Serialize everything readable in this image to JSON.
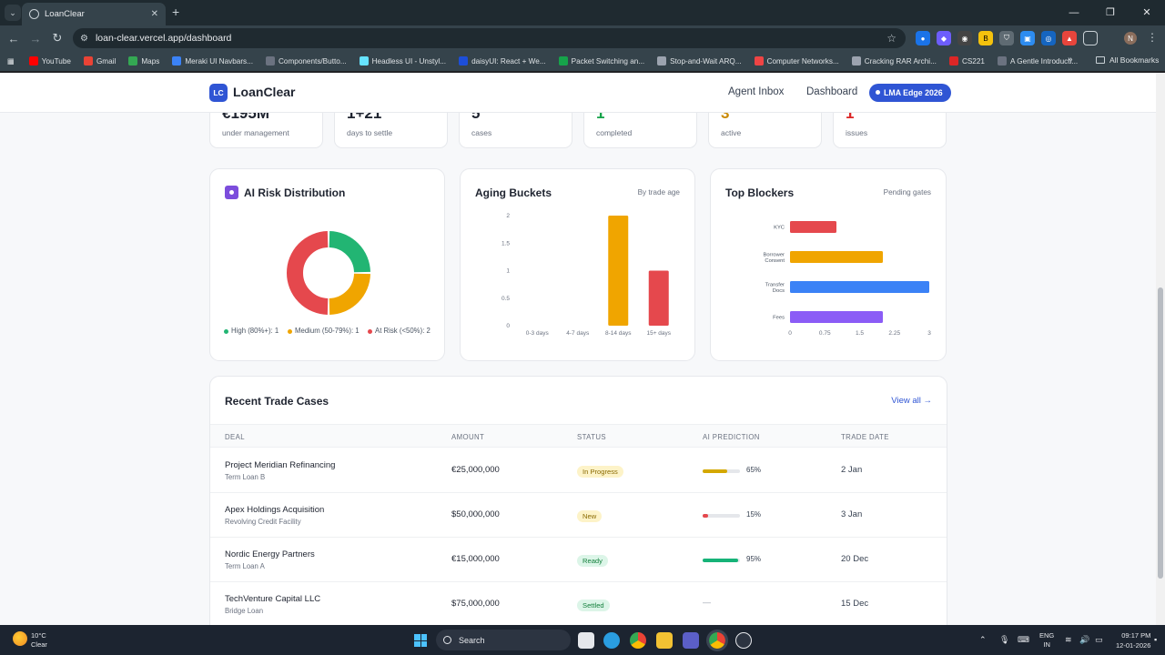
{
  "browser": {
    "tab_title": "LoanClear",
    "url": "loan-clear.vercel.app/dashboard",
    "bookmarks": [
      {
        "label": "YouTube",
        "color": "#ff0000"
      },
      {
        "label": "Gmail",
        "color": "#ea4335"
      },
      {
        "label": "Maps",
        "color": "#34a853"
      },
      {
        "label": "Meraki UI Navbars...",
        "color": "#3b82f6"
      },
      {
        "label": "Components/Butto...",
        "color": "#6b7280"
      },
      {
        "label": "Headless UI - Unstyl...",
        "color": "#66e3ff"
      },
      {
        "label": "daisyUI: React + We...",
        "color": "#1d4ed8"
      },
      {
        "label": "Packet Switching an...",
        "color": "#16a34a"
      },
      {
        "label": "Stop-and-Wait ARQ...",
        "color": "#9ca3af"
      },
      {
        "label": "Computer Networks...",
        "color": "#ef4444"
      },
      {
        "label": "Cracking RAR Archi...",
        "color": "#9ca3af"
      },
      {
        "label": "CS221",
        "color": "#dc2626"
      },
      {
        "label": "A Gentle Introducti...",
        "color": "#6b7280"
      }
    ],
    "all_bookmarks": "All Bookmarks",
    "profile_initial": "N"
  },
  "nav": {
    "logo": "LC",
    "brand": "LoanClear",
    "links": [
      "Agent Inbox",
      "Dashboard"
    ],
    "pill": "LMA Edge 2026"
  },
  "stats": [
    {
      "value": "€195M",
      "label": "under management",
      "color": "#1f2430"
    },
    {
      "value": "1+21",
      "label": "days to settle",
      "color": "#1f2430"
    },
    {
      "value": "5",
      "label": "cases",
      "color": "#1f2430"
    },
    {
      "value": "1",
      "label": "completed",
      "color": "#16a34a"
    },
    {
      "value": "3",
      "label": "active",
      "color": "#ca8a04"
    },
    {
      "value": "1",
      "label": "issues",
      "color": "#dc2626"
    }
  ],
  "charts": {
    "risk": {
      "title": "AI Risk Distribution",
      "legend": [
        {
          "label": "High (80%+): 1",
          "color": "#22b573"
        },
        {
          "label": "Medium (50-79%): 1",
          "color": "#f0a500"
        },
        {
          "label": "At Risk (<50%): 2",
          "color": "#e5484d"
        }
      ]
    },
    "aging": {
      "title": "Aging Buckets",
      "subtitle": "By trade age"
    },
    "blockers": {
      "title": "Top Blockers",
      "subtitle": "Pending gates"
    }
  },
  "chart_data": [
    {
      "type": "pie",
      "title": "AI Risk Distribution",
      "labels": [
        "High (80%+)",
        "Medium (50-79%)",
        "At Risk (<50%)"
      ],
      "values": [
        1,
        1,
        2
      ],
      "colors": [
        "#22b573",
        "#f0a500",
        "#e5484d"
      ]
    },
    {
      "type": "bar",
      "title": "Aging Buckets",
      "categories": [
        "0-3 days",
        "4-7 days",
        "8-14 days",
        "15+ days"
      ],
      "values": [
        0,
        0,
        2,
        1
      ],
      "colors": [
        "#f0a500",
        "#f0a500",
        "#f0a500",
        "#e5484d"
      ],
      "ylim": [
        0,
        2
      ],
      "yticks": [
        "0",
        "0.5",
        "1",
        "1.5",
        "2"
      ]
    },
    {
      "type": "bar",
      "orientation": "horizontal",
      "title": "Top Blockers",
      "categories": [
        "KYC",
        "Borrower Consent",
        "Transfer Docs",
        "Fees"
      ],
      "category_lines": [
        [
          "KYC"
        ],
        [
          "Borrower",
          "Consent"
        ],
        [
          "Transfer",
          "Docs"
        ],
        [
          "Fees"
        ]
      ],
      "values": [
        1,
        2,
        3,
        2
      ],
      "colors": [
        "#e5484d",
        "#f0a500",
        "#3b82f6",
        "#8b5cf6"
      ],
      "xlim": [
        0,
        3
      ],
      "xticks": [
        "0",
        "0.75",
        "1.5",
        "2.25",
        "3"
      ]
    }
  ],
  "table": {
    "title": "Recent Trade Cases",
    "view_all": "View all →",
    "columns": [
      "DEAL",
      "AMOUNT",
      "STATUS",
      "AI PREDICTION",
      "TRADE DATE"
    ],
    "rows": [
      {
        "deal": "Project Meridian Refinancing",
        "facility": "Term Loan B",
        "amount": "€25,000,000",
        "status": "In Progress",
        "status_bg": "#fdf3c8",
        "status_fg": "#8a6a00",
        "prediction": 65,
        "prediction_label": "65%",
        "bar_color": "#d4a800",
        "date": "2 Jan"
      },
      {
        "deal": "Apex Holdings Acquisition",
        "facility": "Revolving Credit Facility",
        "amount": "$50,000,000",
        "status": "New",
        "status_bg": "#fdf3c8",
        "status_fg": "#8a6a00",
        "prediction": 15,
        "prediction_label": "15%",
        "bar_color": "#e5484d",
        "date": "3 Jan"
      },
      {
        "deal": "Nordic Energy Partners",
        "facility": "Term Loan A",
        "amount": "€15,000,000",
        "status": "Ready",
        "status_bg": "#dcf5e8",
        "status_fg": "#15803d",
        "prediction": 95,
        "prediction_label": "95%",
        "bar_color": "#16b378",
        "date": "20 Dec"
      },
      {
        "deal": "TechVenture Capital LLC",
        "facility": "Bridge Loan",
        "amount": "$75,000,000",
        "status": "Settled",
        "status_bg": "#dcf5e8",
        "status_fg": "#15803d",
        "prediction": null,
        "prediction_label": "—",
        "bar_color": "",
        "date": "15 Dec"
      }
    ]
  },
  "taskbar": {
    "temp": "10°C",
    "condition": "Clear",
    "search": "Search",
    "lang_top": "ENG",
    "lang_bottom": "IN",
    "time": "09:17 PM",
    "date": "12-01-2026"
  }
}
